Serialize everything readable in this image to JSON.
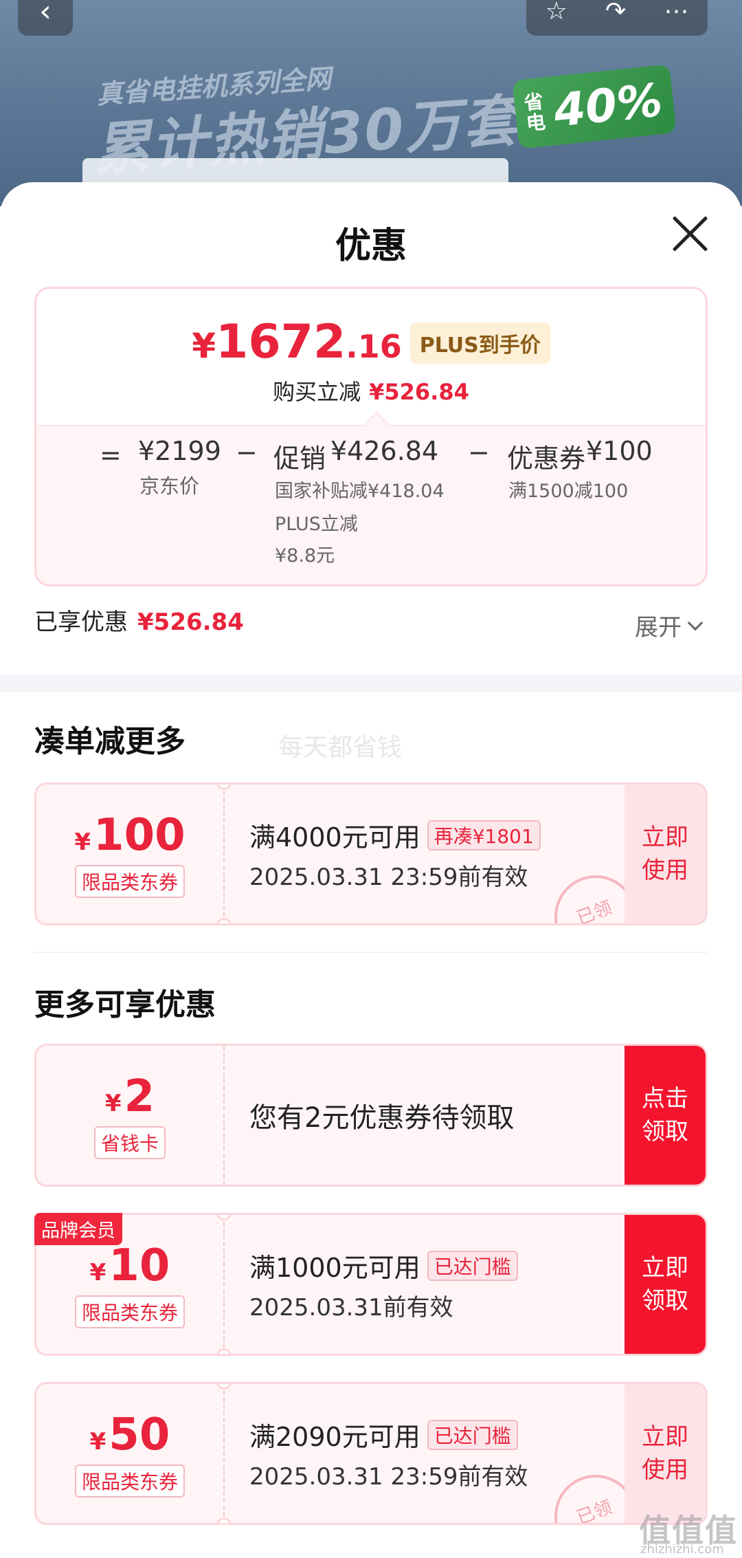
{
  "banner": {
    "line1": "真省电挂机系列全网",
    "line2": "累计热销30万套",
    "badge_small": "省电",
    "badge_big": "40%"
  },
  "top_actions": {
    "back": "‹",
    "favorite": "☆",
    "share": "↷",
    "more": "⋯"
  },
  "sheet": {
    "title": "优惠"
  },
  "price_card": {
    "yen": "¥",
    "price_int": "1672",
    "price_dec": ".16",
    "plus_tag": "PLUS到手价",
    "reduce_label": "购买立减",
    "reduce_value": "¥526.84",
    "eq": "=",
    "minus1": "−",
    "minus2": "−",
    "jd_price": "¥2199",
    "jd_price_label": "京东价",
    "promo_label": "促销",
    "promo_value": "¥426.84",
    "promo_sub1": "国家补贴减¥418.04",
    "promo_sub2": "PLUS立减",
    "promo_sub3": "¥8.8元",
    "coupon_label": "优惠券",
    "coupon_value": "¥100",
    "coupon_sub": "满1500减100"
  },
  "enjoyed": {
    "label": "已享优惠",
    "value": "¥526.84",
    "expand": "展开"
  },
  "section1": {
    "title": "凑单减更多",
    "watermark": "每天都省钱"
  },
  "section2": {
    "title": "更多可享优惠"
  },
  "coupons": [
    {
      "yen": "¥",
      "amount": "100",
      "tag": "限品类东券",
      "condition": "满4000元可用",
      "cond_tag": "再凑¥1801",
      "valid": "2025.03.31 23:59前有效",
      "action": "立即使用",
      "stamp": "已领"
    },
    {
      "yen": "¥",
      "amount": "2",
      "tag": "省钱卡",
      "text": "您有2元优惠券待领取",
      "action": "点击领取"
    },
    {
      "badge": "品牌会员",
      "yen": "¥",
      "amount": "10",
      "tag": "限品类东券",
      "condition": "满1000元可用",
      "cond_tag": "已达门槛",
      "valid": "2025.03.31前有效",
      "action": "立即领取"
    },
    {
      "yen": "¥",
      "amount": "50",
      "tag": "限品类东券",
      "condition": "满2090元可用",
      "cond_tag": "已达门槛",
      "valid": "2025.03.31 23:59前有效",
      "action": "立即使用",
      "stamp": "已领"
    }
  ],
  "site_watermark": {
    "logo": "值值值",
    "url": "zhizhizhi.com"
  },
  "colors": {
    "accent_red": "#e8233b",
    "button_red": "#f5142d",
    "plus_gold": "#8a5a17",
    "coupon_bg": "#fff5f6"
  }
}
